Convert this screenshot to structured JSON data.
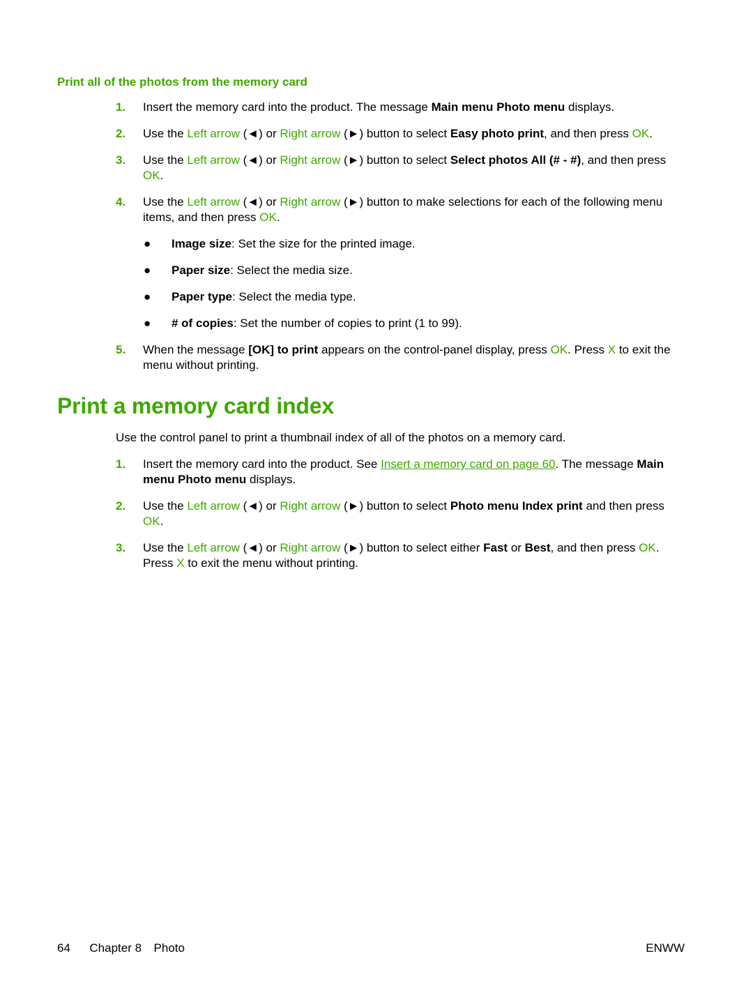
{
  "section1": {
    "subheading": "Print all of the photos from the memory card",
    "steps": [
      {
        "num": "1.",
        "parts": [
          [
            "t",
            "Insert the memory card into the product. The message "
          ],
          [
            "b",
            "Main menu Photo menu"
          ],
          [
            "t",
            " displays."
          ]
        ]
      },
      {
        "num": "2.",
        "parts": [
          [
            "t",
            "Use the "
          ],
          [
            "g",
            "Left arrow"
          ],
          [
            "t",
            " (◄) or "
          ],
          [
            "g",
            "Right arrow"
          ],
          [
            "t",
            " (►) button to select "
          ],
          [
            "b",
            "Easy photo print"
          ],
          [
            "t",
            ", and then press "
          ],
          [
            "g",
            "OK"
          ],
          [
            "t",
            "."
          ]
        ]
      },
      {
        "num": "3.",
        "parts": [
          [
            "t",
            "Use the "
          ],
          [
            "g",
            "Left arrow"
          ],
          [
            "t",
            " (◄) or "
          ],
          [
            "g",
            "Right arrow"
          ],
          [
            "t",
            " (►) button to select "
          ],
          [
            "b",
            "Select photos All (# - #)"
          ],
          [
            "t",
            ", and then press "
          ],
          [
            "g",
            "OK"
          ],
          [
            "t",
            "."
          ]
        ]
      },
      {
        "num": "4.",
        "parts": [
          [
            "t",
            "Use the "
          ],
          [
            "g",
            "Left arrow"
          ],
          [
            "t",
            " (◄) or "
          ],
          [
            "g",
            "Right arrow"
          ],
          [
            "t",
            " (►) button to make selections for each of the following menu items, and then press "
          ],
          [
            "g",
            "OK"
          ],
          [
            "t",
            "."
          ]
        ]
      },
      {
        "num": "5.",
        "parts": [
          [
            "t",
            "When the message "
          ],
          [
            "b",
            "[OK] to print"
          ],
          [
            "t",
            " appears on the control-panel display, press "
          ],
          [
            "g",
            "OK"
          ],
          [
            "t",
            ". Press "
          ],
          [
            "g",
            "X"
          ],
          [
            "t",
            " to exit the menu without printing."
          ]
        ]
      }
    ],
    "bullets": [
      {
        "term": "Image size",
        "desc": ": Set the size for the printed image."
      },
      {
        "term": "Paper size",
        "desc": ": Select the media size."
      },
      {
        "term": "Paper type",
        "desc": ": Select the media type."
      },
      {
        "term": "# of copies",
        "desc": ": Set the number of copies to print (1 to 99)."
      }
    ],
    "bullet_glyph": "●"
  },
  "section2": {
    "heading": "Print a memory card index",
    "intro": "Use the control panel to print a thumbnail index of all of the photos on a memory card.",
    "steps": [
      {
        "num": "1.",
        "parts": [
          [
            "t",
            "Insert the memory card into the product. See "
          ],
          [
            "l",
            "Insert a memory card on page 60"
          ],
          [
            "t",
            ". The message "
          ],
          [
            "b",
            "Main menu Photo menu"
          ],
          [
            "t",
            " displays."
          ]
        ]
      },
      {
        "num": "2.",
        "parts": [
          [
            "t",
            "Use the "
          ],
          [
            "g",
            "Left arrow"
          ],
          [
            "t",
            " (◄) or "
          ],
          [
            "g",
            "Right arrow"
          ],
          [
            "t",
            " (►) button to select "
          ],
          [
            "b",
            "Photo menu Index print"
          ],
          [
            "t",
            " and then press "
          ],
          [
            "g",
            "OK"
          ],
          [
            "t",
            "."
          ]
        ]
      },
      {
        "num": "3.",
        "parts": [
          [
            "t",
            "Use the "
          ],
          [
            "g",
            "Left arrow"
          ],
          [
            "t",
            " (◄) or "
          ],
          [
            "g",
            "Right arrow"
          ],
          [
            "t",
            " (►) button to select either "
          ],
          [
            "b",
            "Fast"
          ],
          [
            "t",
            " or "
          ],
          [
            "b",
            "Best"
          ],
          [
            "t",
            ", and then press "
          ],
          [
            "g",
            "OK"
          ],
          [
            "t",
            ". Press "
          ],
          [
            "g",
            "X"
          ],
          [
            "t",
            " to exit the menu without printing."
          ]
        ]
      }
    ]
  },
  "footer": {
    "page_number": "64",
    "chapter": "Chapter 8",
    "section": "Photo",
    "locale": "ENWW"
  },
  "colors": {
    "accent": "#3fa800",
    "text": "#000000"
  }
}
